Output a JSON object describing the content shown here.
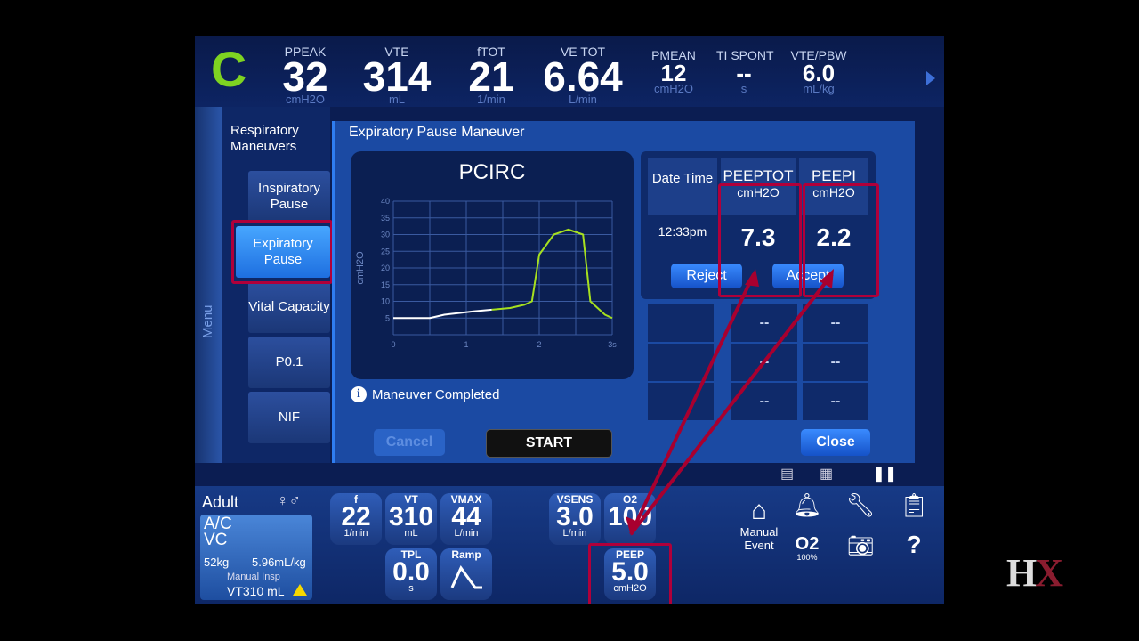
{
  "app": {
    "status_letter": "C"
  },
  "monitors": [
    {
      "label": "PPEAK",
      "value": "32",
      "unit": "cmH2O"
    },
    {
      "label": "VTE",
      "value": "314",
      "unit": "mL"
    },
    {
      "label": "fTOT",
      "value": "21",
      "unit": "1/min"
    },
    {
      "label": "VE TOT",
      "value": "6.64",
      "unit": "L/min"
    },
    {
      "label": "PMEAN",
      "value": "12",
      "unit": "cmH2O"
    },
    {
      "label": "TI SPONT",
      "value": "--",
      "unit": "s"
    },
    {
      "label": "VTE/PBW",
      "value": "6.0",
      "unit": "mL/kg"
    }
  ],
  "sidebar": {
    "menu_label": "Menu",
    "title": "Respiratory Maneuvers",
    "items": [
      {
        "label": "Inspiratory Pause"
      },
      {
        "label": "Expiratory Pause"
      },
      {
        "label": "Vital Capacity"
      },
      {
        "label": "P0.1"
      },
      {
        "label": "NIF"
      }
    ]
  },
  "maneuver": {
    "title": "Expiratory Pause Maneuver",
    "graph_title": "PCIRC",
    "graph_ylabel": "cmH2O",
    "status": "Maneuver Completed",
    "cancel_label": "Cancel",
    "start_label": "START",
    "close_label": "Close",
    "reject_label": "Reject",
    "accept_label": "Accept",
    "results": {
      "date_time_header": "Date Time",
      "peep_tot_header": "PEEPTOT",
      "peep_i_header": "PEEPI",
      "unit": "cmH2O",
      "time": "12:33pm",
      "peep_tot": "7.3",
      "peep_i": "2.2",
      "empty": "--"
    }
  },
  "chart_data": {
    "type": "line",
    "title": "PCIRC",
    "ylabel": "cmH2O",
    "x_ticks": [
      "0",
      "1",
      "2",
      "3s"
    ],
    "y_ticks": [
      "5",
      "10",
      "15",
      "20",
      "25",
      "30",
      "35",
      "40"
    ],
    "xlim": [
      0,
      3
    ],
    "ylim": [
      0,
      40
    ],
    "series": [
      {
        "color": "#ffffff",
        "x": [
          0,
          0.3,
          0.5,
          0.7,
          0.9,
          1.1,
          1.35
        ],
        "y": [
          5,
          5,
          5,
          6,
          6.5,
          7,
          7.5
        ]
      },
      {
        "color": "#a6e01f",
        "x": [
          1.35,
          1.6,
          1.8,
          1.9,
          2.0,
          2.2,
          2.4,
          2.6,
          2.7,
          2.9,
          3.0
        ],
        "y": [
          7.5,
          8,
          9,
          10,
          24,
          30,
          31.5,
          30,
          10,
          6,
          5
        ]
      }
    ]
  },
  "bottom": {
    "patient_type": "Adult",
    "mode_line1": "A/C",
    "mode_line2": "VC",
    "weight": "52kg",
    "vt_per_kg": "5.96mL/kg",
    "manual_insp_label": "Manual Insp",
    "manual_insp_value": "VT310 mL",
    "settings": [
      {
        "label": "f",
        "value": "22",
        "unit": "1/min"
      },
      {
        "label": "VT",
        "value": "310",
        "unit": "mL"
      },
      {
        "label": "VMAX",
        "value": "44",
        "unit": "L/min"
      },
      {
        "label": "TPL",
        "value": "0.0",
        "unit": "s"
      },
      {
        "label": "Ramp",
        "value": "",
        "unit": ""
      },
      {
        "label": "VSENS",
        "value": "3.0",
        "unit": "L/min"
      },
      {
        "label": "O2",
        "value": "100",
        "unit": ""
      },
      {
        "label": "PEEP",
        "value": "5.0",
        "unit": "cmH2O"
      }
    ],
    "manual_event_label": "Manual Event",
    "o2_label": "O2",
    "o2_sub": "100%"
  },
  "watermark": "HX"
}
